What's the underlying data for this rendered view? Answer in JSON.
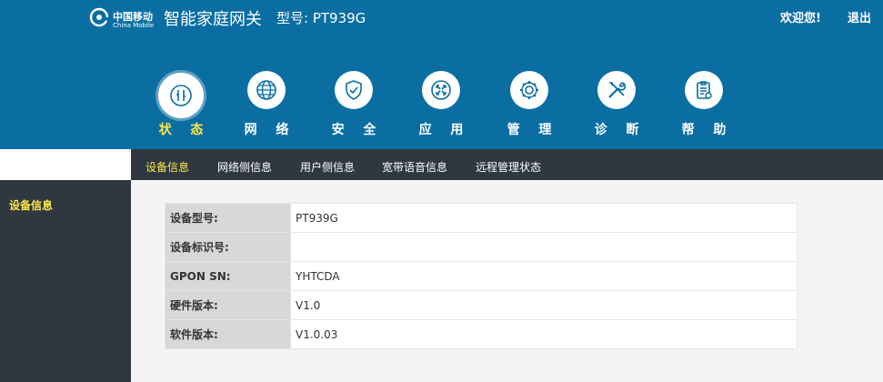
{
  "brand": {
    "logo_cn": "中国移动",
    "logo_en": "China Mobile",
    "gateway_title": "智能家庭网关",
    "model_title": "型号: PT939G"
  },
  "user": {
    "welcome": "欢迎您!",
    "logout": "退出"
  },
  "nav": [
    {
      "label": "状 态",
      "icon": "status-icon",
      "active": true
    },
    {
      "label": "网 络",
      "icon": "globe-icon",
      "active": false
    },
    {
      "label": "安 全",
      "icon": "shield-icon",
      "active": false
    },
    {
      "label": "应 用",
      "icon": "apps-icon",
      "active": false
    },
    {
      "label": "管 理",
      "icon": "gear-icon",
      "active": false
    },
    {
      "label": "诊 断",
      "icon": "tools-icon",
      "active": false
    },
    {
      "label": "帮 助",
      "icon": "help-doc-icon",
      "active": false
    }
  ],
  "subtabs": [
    {
      "label": "设备信息",
      "active": true
    },
    {
      "label": "网络侧信息",
      "active": false
    },
    {
      "label": "用户侧信息",
      "active": false
    },
    {
      "label": "宽带语音信息",
      "active": false
    },
    {
      "label": "远程管理状态",
      "active": false
    }
  ],
  "sidebar": {
    "items": [
      {
        "label": "设备信息",
        "active": true
      }
    ]
  },
  "device_info": {
    "rows": [
      {
        "key": "设备型号:",
        "value": "PT939G"
      },
      {
        "key": "设备标识号:",
        "value": ""
      },
      {
        "key": "GPON SN:",
        "value": "YHTCDA"
      },
      {
        "key": "硬件版本:",
        "value": "V1.0"
      },
      {
        "key": "软件版本:",
        "value": "V1.0.03"
      }
    ]
  },
  "colors": {
    "header_bg": "#0a6ea3",
    "dark_bar": "#2f3740",
    "active_text": "#ffe84c",
    "content_bg": "#f4f4f4"
  }
}
